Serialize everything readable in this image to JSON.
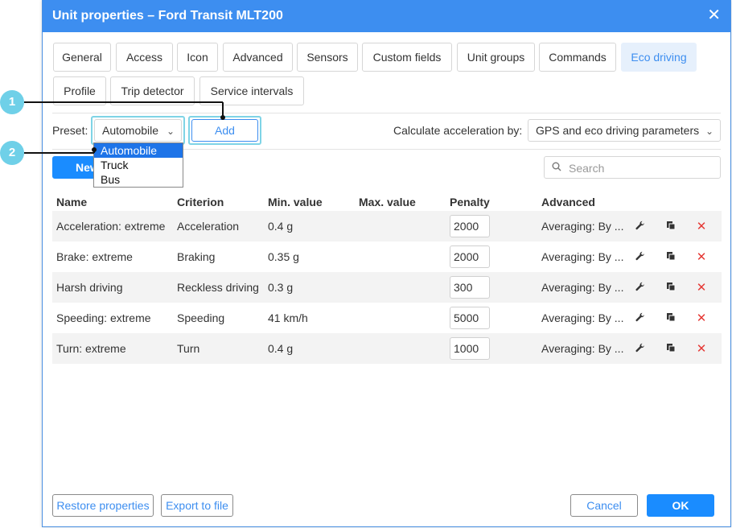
{
  "window": {
    "title": "Unit properties – Ford Transit MLT200",
    "close_glyph": "✕"
  },
  "tabs": [
    {
      "label": "General"
    },
    {
      "label": "Access"
    },
    {
      "label": "Icon"
    },
    {
      "label": "Advanced"
    },
    {
      "label": "Sensors"
    },
    {
      "label": "Custom fields"
    },
    {
      "label": "Unit groups"
    },
    {
      "label": "Commands"
    },
    {
      "label": "Eco driving",
      "active": true
    },
    {
      "label": "Profile"
    },
    {
      "label": "Trip detector"
    },
    {
      "label": "Service intervals"
    }
  ],
  "preset": {
    "label": "Preset:",
    "value": "Automobile",
    "add_label": "Add",
    "options": [
      "Automobile",
      "Truck",
      "Bus"
    ],
    "selected_index": 0
  },
  "acceleration": {
    "label": "Calculate acceleration by:",
    "value": "GPS and eco driving parameters"
  },
  "new_button": "New",
  "search": {
    "placeholder": "Search"
  },
  "table": {
    "headers": [
      "Name",
      "Criterion",
      "Min. value",
      "Max. value",
      "Penalty",
      "Advanced"
    ],
    "rows": [
      {
        "name": "Acceleration: extreme",
        "criterion": "Acceleration",
        "min": "0.4 g",
        "max": "",
        "penalty": "2000",
        "advanced": "Averaging: By ..."
      },
      {
        "name": "Brake: extreme",
        "criterion": "Braking",
        "min": "0.35 g",
        "max": "",
        "penalty": "2000",
        "advanced": "Averaging: By ..."
      },
      {
        "name": "Harsh driving",
        "criterion": "Reckless driving",
        "min": "0.3 g",
        "max": "",
        "penalty": "300",
        "advanced": "Averaging: By ..."
      },
      {
        "name": "Speeding: extreme",
        "criterion": "Speeding",
        "min": "41 km/h",
        "max": "",
        "penalty": "5000",
        "advanced": "Averaging: By ..."
      },
      {
        "name": "Turn: extreme",
        "criterion": "Turn",
        "min": "0.4 g",
        "max": "",
        "penalty": "1000",
        "advanced": "Averaging: By ..."
      }
    ]
  },
  "footer": {
    "restore": "Restore properties",
    "export": "Export to file",
    "cancel": "Cancel",
    "ok": "OK"
  },
  "callouts": [
    {
      "number": "1"
    },
    {
      "number": "2"
    }
  ],
  "colors": {
    "accent": "#3d8ef0",
    "delete": "#e53935",
    "callout": "#6fd0e8"
  }
}
